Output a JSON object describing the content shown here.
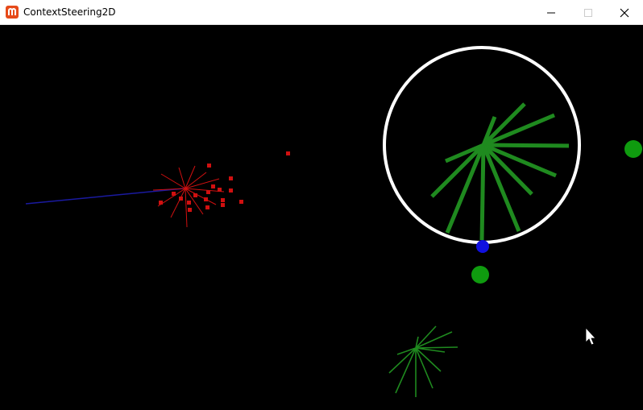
{
  "window": {
    "title": "ContextSteering2D",
    "icon": "monogame-logo-icon",
    "controls": [
      "minimize-icon",
      "maximize-icon",
      "close-icon"
    ]
  },
  "scene": {
    "background": "#000000",
    "colors": {
      "ring": "#ffffff",
      "green": "#1f8a1f",
      "target": "#0f9b0f",
      "blue_agent": "#1010e0",
      "red": "#d01010",
      "trail": "#1a1aa0",
      "cursor": "#ffffff"
    }
  }
}
